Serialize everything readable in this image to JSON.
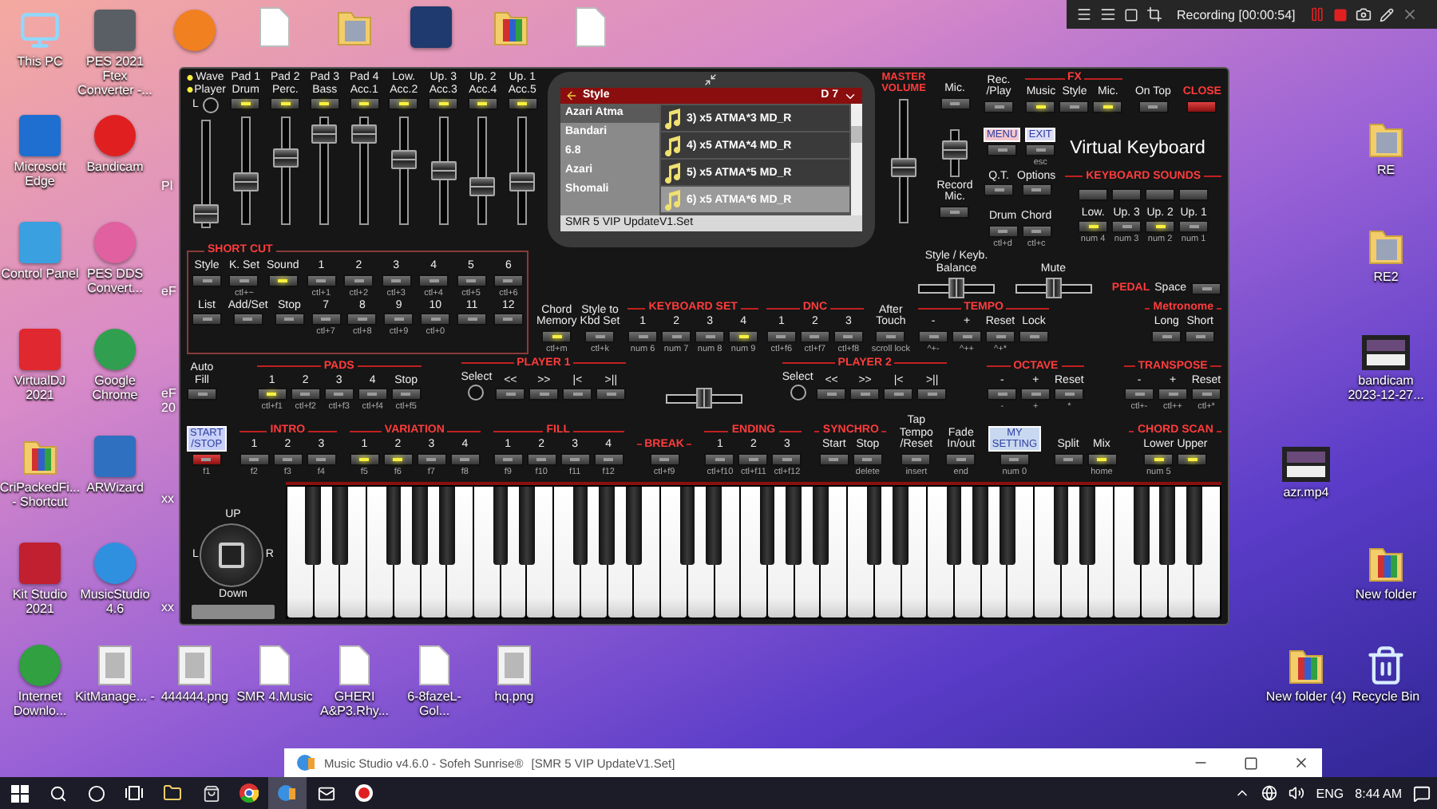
{
  "recorder_bar": {
    "status": "Recording [00:00:54]"
  },
  "desktop": [
    {
      "kind": "computer",
      "label": "This PC"
    },
    {
      "kind": "tile",
      "color": "#5a5f66",
      "label": "PES 2021 Ftex Converter -..."
    },
    {
      "kind": "disc",
      "color": "#f08020"
    },
    {
      "kind": "file"
    },
    {
      "kind": "folder"
    },
    {
      "kind": "tile",
      "color": "#1e3a6e"
    },
    {
      "kind": "archive"
    },
    {
      "kind": "file"
    },
    {
      "kind": "tile",
      "color": "#1f6fd0",
      "label": "Microsoft Edge"
    },
    {
      "kind": "disc",
      "color": "#e02020",
      "label": "Bandicam"
    },
    {
      "kind": "partial",
      "label": "Pl"
    },
    {
      "kind": "tile",
      "color": "#3aa0e0",
      "label": "Control Panel"
    },
    {
      "kind": "disc",
      "color": "#e060a0",
      "label": "PES DDS Convert..."
    },
    {
      "kind": "partial",
      "label": "eF"
    },
    {
      "kind": "tile",
      "color": "#e02830",
      "label": "VirtualDJ 2021"
    },
    {
      "kind": "disc",
      "color": "#30a050",
      "label": "Google Chrome"
    },
    {
      "kind": "partial",
      "label": "eF 20"
    },
    {
      "kind": "archive",
      "label": "CriPackedFi... - Shortcut"
    },
    {
      "kind": "tile",
      "color": "#3070c0",
      "label": "ARWizard"
    },
    {
      "kind": "partial",
      "label": "xx"
    },
    {
      "kind": "tile",
      "color": "#c02030",
      "label": "Kit Studio 2021"
    },
    {
      "kind": "disc",
      "color": "#3090e0",
      "label": "MusicStudio 4.6"
    },
    {
      "kind": "partial",
      "label": "xx"
    },
    {
      "kind": "disc",
      "color": "#30a040",
      "label": "Internet Downlo..."
    },
    {
      "kind": "image",
      "label": "KitManage... -"
    },
    {
      "kind": "image",
      "label": "444444.png"
    },
    {
      "kind": "file",
      "label": "SMR 4.Music"
    },
    {
      "kind": "file",
      "label": "GHERI A&P3.Rhy..."
    },
    {
      "kind": "file",
      "label": "6-8fazeL-Gol..."
    },
    {
      "kind": "image",
      "label": "hq.png"
    },
    {
      "kind": "folder",
      "label": "RE"
    },
    {
      "kind": "folder",
      "label": "RE2"
    },
    {
      "kind": "video",
      "label": "bandicam 2023-12-27..."
    },
    {
      "kind": "video",
      "label": "azr.mp4"
    },
    {
      "kind": "archive",
      "label": "New folder"
    },
    {
      "kind": "archive",
      "label": "New folder (4)"
    },
    {
      "kind": "recycle",
      "label": "Recycle Bin"
    }
  ],
  "panel": {
    "mixer": [
      {
        "kind": "player",
        "top": "Wave",
        "bottom": "Player",
        "side": "L",
        "on": true,
        "level": 0.12
      },
      {
        "kind": "track",
        "top": "Pad 1",
        "bottom": "Drum",
        "on": true,
        "level": 0.4
      },
      {
        "kind": "track",
        "top": "Pad 2",
        "bottom": "Perc.",
        "on": true,
        "level": 0.62
      },
      {
        "kind": "track",
        "top": "Pad 3",
        "bottom": "Bass",
        "on": true,
        "level": 0.85
      },
      {
        "kind": "track",
        "top": "Pad 4",
        "bottom": "Acc.1",
        "on": true,
        "level": 0.85
      },
      {
        "kind": "track",
        "top": "Low.",
        "bottom": "Acc.2",
        "on": true,
        "level": 0.6
      },
      {
        "kind": "track",
        "top": "Up. 3",
        "bottom": "Acc.3",
        "on": true,
        "level": 0.5
      },
      {
        "kind": "track",
        "top": "Up. 2",
        "bottom": "Acc.4",
        "on": true,
        "level": 0.35
      },
      {
        "kind": "track",
        "top": "Up. 1",
        "bottom": "Acc.5",
        "on": true,
        "level": 0.4
      }
    ],
    "screen": {
      "title": "Style",
      "key": "D 7",
      "categories": [
        {
          "label": "Azari Atma",
          "selected": true
        },
        {
          "label": "Bandari",
          "selected": false
        },
        {
          "label": "6.8",
          "selected": false
        },
        {
          "label": "Azari",
          "selected": false
        },
        {
          "label": "Shomali",
          "selected": false
        }
      ],
      "styles": [
        {
          "label": "3) x5 ATMA*3 MD_R",
          "selected": false
        },
        {
          "label": "4) x5 ATMA*4 MD_R",
          "selected": false
        },
        {
          "label": "5) x5 ATMA*5 MD_R",
          "selected": false
        },
        {
          "label": "6) x5 ATMA*6 MD_R",
          "selected": true
        }
      ],
      "footer": "SMR 5 VIP UpdateV1.Set"
    },
    "master_volume": {
      "title": "MASTER VOLUME",
      "level": 0.45
    },
    "mic": {
      "button": {
        "label": "Mic.",
        "on": false
      },
      "level": 0.55,
      "record": {
        "label": "Record\nMic.",
        "on": false
      }
    },
    "top_bar": [
      {
        "controls": [
          {
            "label": "Rec.\n/Play",
            "on": false
          }
        ]
      },
      {
        "title": "FX",
        "controls": [
          {
            "label": "Music",
            "on": true
          },
          {
            "label": "Style",
            "on": false
          },
          {
            "label": "Mic.",
            "on": true
          }
        ]
      },
      {
        "controls": [
          {
            "label": "On Top",
            "on": false
          }
        ]
      },
      {
        "controls": [
          {
            "kind": "close",
            "label": "CLOSE"
          }
        ]
      }
    ],
    "menu": [
      {
        "kind": "boxed",
        "label": "MENU",
        "color": "#f4c6cf",
        "on": false
      },
      {
        "kind": "boxed",
        "label": "EXIT",
        "color": "#dcdcf6",
        "on": false,
        "hint": "esc"
      }
    ],
    "app_title": "Virtual Keyboard",
    "options": [
      {
        "label": "Q.T.",
        "on": false
      },
      {
        "label": "Options",
        "on": false
      }
    ],
    "drum_chord": [
      {
        "label": "Drum",
        "on": false,
        "hint": "ctl+d"
      },
      {
        "label": "Chord",
        "on": false,
        "hint": "ctl+c"
      }
    ],
    "keyboard_sounds": {
      "title": "KEYBOARD SOUNDS",
      "controls": [
        {
          "label": "Low.",
          "on": true,
          "hint": "num 4"
        },
        {
          "label": "Up. 3",
          "on": false,
          "hint": "num 3"
        },
        {
          "label": "Up. 2",
          "on": true,
          "hint": "num 2"
        },
        {
          "label": "Up. 1",
          "on": false,
          "hint": "num 1"
        }
      ]
    },
    "shortcut": {
      "title": "SHORT CUT",
      "rows": [
        [
          {
            "label": "Style",
            "on": false
          },
          {
            "label": "K. Set",
            "on": false,
            "hint": "ctl+~"
          },
          {
            "label": "Sound",
            "on": true
          },
          {
            "label": "1",
            "on": false,
            "hint": "ctl+1"
          },
          {
            "label": "2",
            "on": false,
            "hint": "ctl+2"
          },
          {
            "label": "3",
            "on": false,
            "hint": "ctl+3"
          },
          {
            "label": "4",
            "on": false,
            "hint": "ctl+4"
          },
          {
            "label": "5",
            "on": false,
            "hint": "ctl+5"
          },
          {
            "label": "6",
            "on": false,
            "hint": "ctl+6"
          }
        ],
        [
          {
            "label": "List",
            "on": false
          },
          {
            "label": "Add/Set",
            "on": false
          },
          {
            "label": "Stop",
            "on": false
          },
          {
            "label": "7",
            "on": false,
            "hint": "ctl+7"
          },
          {
            "label": "8",
            "on": false,
            "hint": "ctl+8"
          },
          {
            "label": "9",
            "on": false,
            "hint": "ctl+9"
          },
          {
            "label": "10",
            "on": false,
            "hint": "ctl+0"
          },
          {
            "label": "11",
            "on": false
          },
          {
            "label": "12",
            "on": false
          }
        ]
      ]
    },
    "memory_strip": [
      {
        "controls": [
          {
            "label": "Chord\nMemory",
            "on": true,
            "hint": "ctl+m"
          },
          {
            "label": "Style to\nKbd Set",
            "on": false,
            "hint": "ctl+k"
          }
        ]
      },
      {
        "title": "KEYBOARD SET",
        "controls": [
          {
            "label": "1",
            "on": false,
            "hint": "num 6"
          },
          {
            "label": "2",
            "on": false,
            "hint": "num 7"
          },
          {
            "label": "3",
            "on": false,
            "hint": "num 8"
          },
          {
            "label": "4",
            "on": true,
            "hint": "num 9"
          }
        ]
      },
      {
        "title": "DNC",
        "controls": [
          {
            "label": "1",
            "on": false,
            "hint": "ctl+f6"
          },
          {
            "label": "2",
            "on": false,
            "hint": "ctl+f7"
          },
          {
            "label": "3",
            "on": false,
            "hint": "ctl+f8"
          }
        ]
      },
      {
        "controls": [
          {
            "label": "After\nTouch",
            "on": false,
            "hint": "scroll lock"
          }
        ]
      }
    ],
    "balance_strip": [
      {
        "kind": "slider",
        "label": "Style / Keyb.\nBalance",
        "level": 0.5
      },
      {
        "kind": "slider",
        "label": "Mute",
        "level": 0.5
      },
      {
        "kind": "pedal",
        "title": "PEDAL",
        "label": "Space",
        "on": false
      }
    ],
    "tempo_strip": [
      {
        "title": "TEMPO",
        "controls": [
          {
            "label": "-",
            "on": false,
            "hint": "^+-"
          },
          {
            "label": "+",
            "on": false,
            "hint": "^++"
          },
          {
            "label": "Reset",
            "on": false,
            "hint": "^+*"
          },
          {
            "label": "Lock",
            "on": false
          }
        ]
      },
      {
        "title": "Metronome",
        "controls": [
          {
            "label": "Long",
            "on": false
          },
          {
            "label": "Short",
            "on": false
          }
        ]
      }
    ],
    "pads_strip": [
      {
        "kind": "group",
        "controls": [
          {
            "kind": "button",
            "label": "Auto\nFill",
            "on": false
          }
        ]
      },
      {
        "kind": "group",
        "title": "PADS",
        "controls": [
          {
            "kind": "button",
            "label": "1",
            "on": true,
            "hint": "ctl+f1"
          },
          {
            "kind": "button",
            "label": "2",
            "on": false,
            "hint": "ctl+f2"
          },
          {
            "kind": "button",
            "label": "3",
            "on": false,
            "hint": "ctl+f3"
          },
          {
            "kind": "button",
            "label": "4",
            "on": false,
            "hint": "ctl+f4"
          },
          {
            "kind": "button",
            "label": "Stop",
            "on": false,
            "hint": "ctl+f5"
          }
        ]
      },
      {
        "kind": "group",
        "title": "PLAYER 1",
        "controls": [
          {
            "kind": "knob",
            "label": "Select"
          },
          {
            "kind": "button",
            "label": "<<",
            "on": false
          },
          {
            "kind": "button",
            "label": ">>",
            "on": false
          },
          {
            "kind": "button",
            "label": "|<",
            "on": false
          },
          {
            "kind": "button",
            "label": ">||",
            "on": false
          }
        ]
      },
      {
        "kind": "slider",
        "level": 0.5
      },
      {
        "kind": "group",
        "title": "PLAYER 2",
        "controls": [
          {
            "kind": "knob",
            "label": "Select"
          },
          {
            "kind": "button",
            "label": "<<",
            "on": false
          },
          {
            "kind": "button",
            "label": ">>",
            "on": false
          },
          {
            "kind": "button",
            "label": "|<",
            "on": false
          },
          {
            "kind": "button",
            "label": ">||",
            "on": false
          }
        ]
      },
      {
        "kind": "group",
        "title": "OCTAVE",
        "controls": [
          {
            "kind": "button",
            "label": "-",
            "on": false,
            "hint": "-"
          },
          {
            "kind": "button",
            "label": "+",
            "on": false,
            "hint": "+"
          },
          {
            "kind": "button",
            "label": "Reset",
            "on": false,
            "hint": "*"
          }
        ]
      },
      {
        "kind": "group",
        "title": "TRANSPOSE",
        "controls": [
          {
            "kind": "button",
            "label": "-",
            "on": false,
            "hint": "ctl+-"
          },
          {
            "kind": "button",
            "label": "+",
            "on": false,
            "hint": "ctl++"
          },
          {
            "kind": "button",
            "label": "Reset",
            "on": false,
            "hint": "ctl+*"
          }
        ]
      }
    ],
    "arranger_strip": [
      {
        "controls": [
          {
            "kind": "start",
            "label": "START\n/STOP",
            "color": "#c8d0f8",
            "on": false,
            "hint": "f1"
          }
        ]
      },
      {
        "title": "INTRO",
        "controls": [
          {
            "label": "1",
            "on": false,
            "hint": "f2"
          },
          {
            "label": "2",
            "on": false,
            "hint": "f3"
          },
          {
            "label": "3",
            "on": false,
            "hint": "f4"
          }
        ]
      },
      {
        "title": "VARIATION",
        "controls": [
          {
            "label": "1",
            "on": true,
            "hint": "f5"
          },
          {
            "label": "2",
            "on": true,
            "hint": "f6"
          },
          {
            "label": "3",
            "on": false,
            "hint": "f7"
          },
          {
            "label": "4",
            "on": false,
            "hint": "f8"
          }
        ]
      },
      {
        "title": "FILL",
        "controls": [
          {
            "label": "1",
            "on": false,
            "hint": "f9"
          },
          {
            "label": "2",
            "on": false,
            "hint": "f10"
          },
          {
            "label": "3",
            "on": false,
            "hint": "f11"
          },
          {
            "label": "4",
            "on": false,
            "hint": "f12"
          }
        ]
      },
      {
        "title": "BREAK",
        "controls": [
          {
            "on": false,
            "hint": "ctl+f9"
          }
        ]
      },
      {
        "title": "ENDING",
        "controls": [
          {
            "label": "1",
            "on": false,
            "hint": "ctl+f10"
          },
          {
            "label": "2",
            "on": false,
            "hint": "ctl+f11"
          },
          {
            "label": "3",
            "on": false,
            "hint": "ctl+f12"
          }
        ]
      },
      {
        "title": "SYNCHRO",
        "controls": [
          {
            "label": "Start",
            "on": false
          },
          {
            "label": "Stop",
            "on": false,
            "hint": "delete"
          }
        ]
      },
      {
        "controls": [
          {
            "label": "Tap\nTempo\n/Reset",
            "on": false,
            "hint": "insert"
          }
        ]
      },
      {
        "controls": [
          {
            "label": "Fade\nIn/out",
            "on": false,
            "hint": "end"
          }
        ]
      },
      {
        "controls": [
          {
            "kind": "boxed",
            "label": "MY\nSETTING",
            "color": "#c8d8f0",
            "on": false,
            "hint": "num 0"
          }
        ]
      },
      {
        "controls": [
          {
            "label": "Split",
            "on": false
          },
          {
            "label": "Mix",
            "on": true,
            "hint": "home"
          }
        ]
      },
      {
        "title": "CHORD SCAN",
        "controls": [
          {
            "label": "Lower",
            "on": true,
            "hint": "num 5"
          },
          {
            "label": "Upper",
            "on": true
          }
        ]
      }
    ],
    "joystick": {
      "up": "UP",
      "down": "Down",
      "left": "L",
      "right": "R"
    }
  },
  "window_bar": {
    "title": "Music Studio v4.6.0 - Sofeh Sunrise®",
    "document": "[SMR 5 VIP UpdateV1.Set]"
  },
  "taskbar": {
    "apps": [
      {
        "kind": "start",
        "selected": false
      },
      {
        "kind": "search",
        "selected": false
      },
      {
        "kind": "cortana",
        "selected": false
      },
      {
        "kind": "taskview",
        "selected": false
      },
      {
        "kind": "explorer",
        "selected": false
      },
      {
        "kind": "store",
        "selected": false
      },
      {
        "kind": "chrome",
        "selected": false
      },
      {
        "kind": "musicstudio",
        "selected": true
      },
      {
        "kind": "mail",
        "selected": false
      },
      {
        "kind": "recorder",
        "selected": false
      }
    ],
    "language": "ENG",
    "time": "8:44 AM"
  }
}
